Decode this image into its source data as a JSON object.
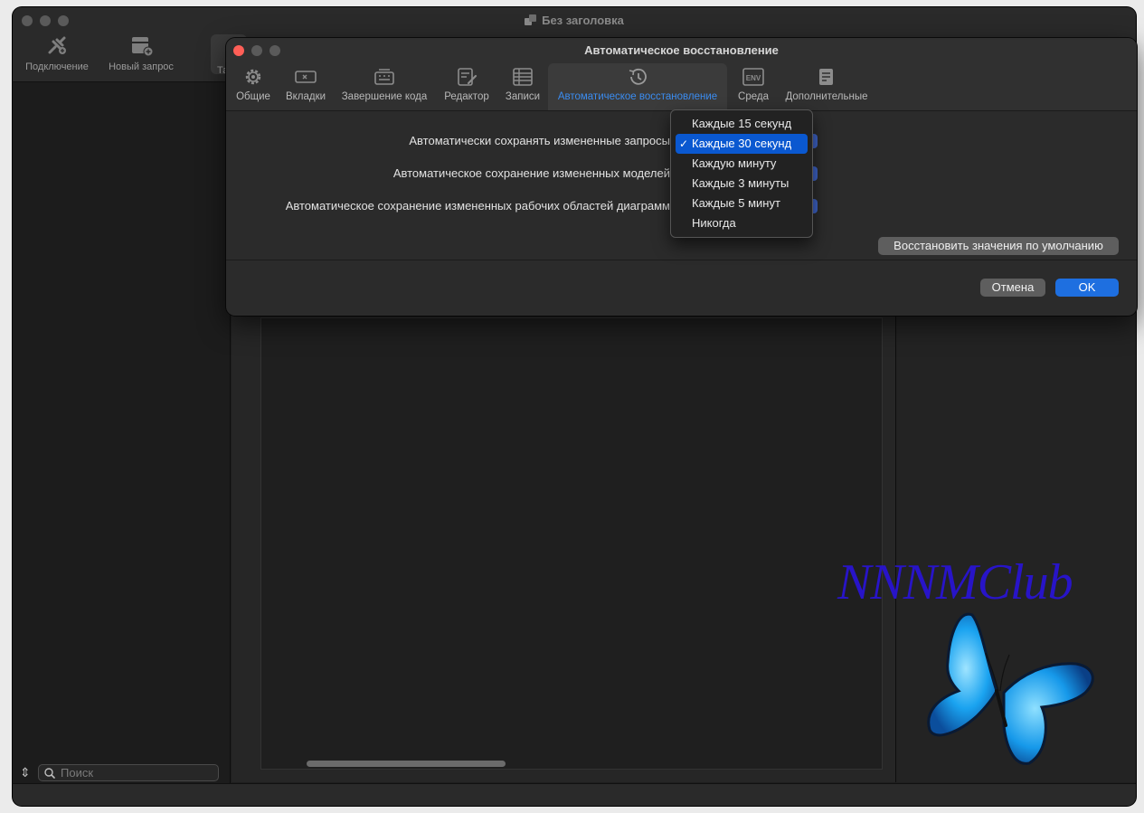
{
  "main_window": {
    "title": "Без заголовка",
    "toolbar": {
      "connection_label": "Подключение",
      "new_query_label": "Новый запрос",
      "partial_label": "Та"
    },
    "sidebar": {
      "search_placeholder": "Поиск",
      "sort_glyph": "⇕"
    }
  },
  "preferences": {
    "title": "Автоматическое восстановление",
    "tabs": [
      {
        "label": "Общие",
        "icon": "gear-icon"
      },
      {
        "label": "Вкладки",
        "icon": "tab-icon"
      },
      {
        "label": "Завершение кода",
        "icon": "keyboard-icon"
      },
      {
        "label": "Редактор",
        "icon": "edit-icon"
      },
      {
        "label": "Записи",
        "icon": "table-icon"
      },
      {
        "label": "Автоматическое восстановление",
        "icon": "history-icon",
        "active": true
      },
      {
        "label": "Среда",
        "icon": "env-icon"
      },
      {
        "label": "Дополнительные",
        "icon": "document-icon"
      }
    ],
    "settings": [
      {
        "label": "Автоматически сохранять измененные запросы"
      },
      {
        "label": "Автоматическое сохранение измененных моделей"
      },
      {
        "label": "Автоматическое сохранение измененных рабочих областей диаграмм"
      }
    ],
    "restore_defaults_label": "Восстановить значения по умолчанию",
    "cancel_label": "Отмена",
    "ok_label": "OK"
  },
  "dropdown": {
    "check_glyph": "✓",
    "items": [
      {
        "label": "Каждые 15 секунд",
        "selected": false
      },
      {
        "label": "Каждые 30 секунд",
        "selected": true
      },
      {
        "label": "Каждую минуту",
        "selected": false
      },
      {
        "label": "Каждые 3 минуты",
        "selected": false
      },
      {
        "label": "Каждые 5 минут",
        "selected": false
      },
      {
        "label": "Никогда",
        "selected": false
      }
    ]
  },
  "watermark": {
    "text": "NNNMClub"
  },
  "colors": {
    "accent": "#1e6fe0",
    "active_tab_text": "#3b8cf0",
    "close_button": "#ff5f57",
    "watermark": "#2814c8"
  }
}
